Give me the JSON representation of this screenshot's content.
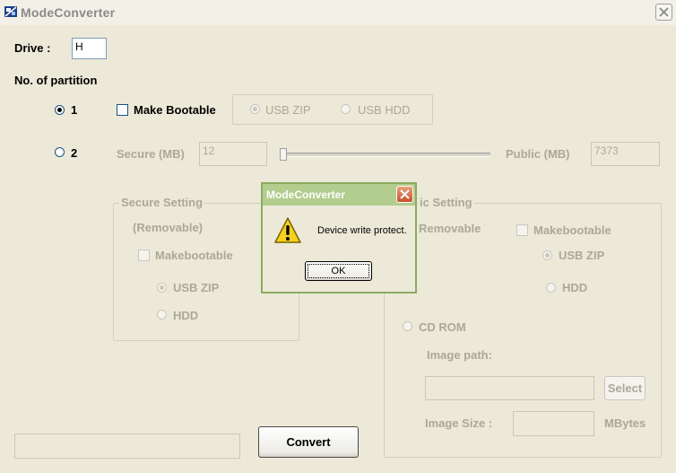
{
  "window": {
    "title": "ModeConverter",
    "close_icon": "close-icon"
  },
  "drive": {
    "label": "Drive :",
    "value": "H"
  },
  "partition": {
    "label": "No. of partition",
    "option1": "1",
    "option2": "2",
    "make_bootable": "Make Bootable",
    "usb_zip": "USB ZIP",
    "usb_hdd": "USB HDD",
    "secure_mb_label": "Secure (MB)",
    "secure_mb_value": "12",
    "public_mb_label": "Public (MB)",
    "public_mb_value": "7373"
  },
  "secure_setting": {
    "title": "Secure Setting",
    "removable": "(Removable)",
    "makebootable": "Makebootable",
    "usb_zip": "USB ZIP",
    "hdd": "HDD"
  },
  "public_setting": {
    "title": "ic Setting",
    "removable": "Removable",
    "makebootable": "Makebootable",
    "usb_zip": "USB ZIP",
    "hdd": "HDD",
    "cd_rom": "CD ROM",
    "image_path_label": "Image path:",
    "image_path_value": "",
    "select_button": "Select",
    "image_size_label": "Image Size :",
    "image_size_value": "",
    "mbytes": "MBytes"
  },
  "status_field": "",
  "convert_button": "Convert",
  "dialog": {
    "title": "ModeConverter",
    "message": "Device write protect.",
    "ok_button": "OK",
    "icon": "warning-icon"
  }
}
